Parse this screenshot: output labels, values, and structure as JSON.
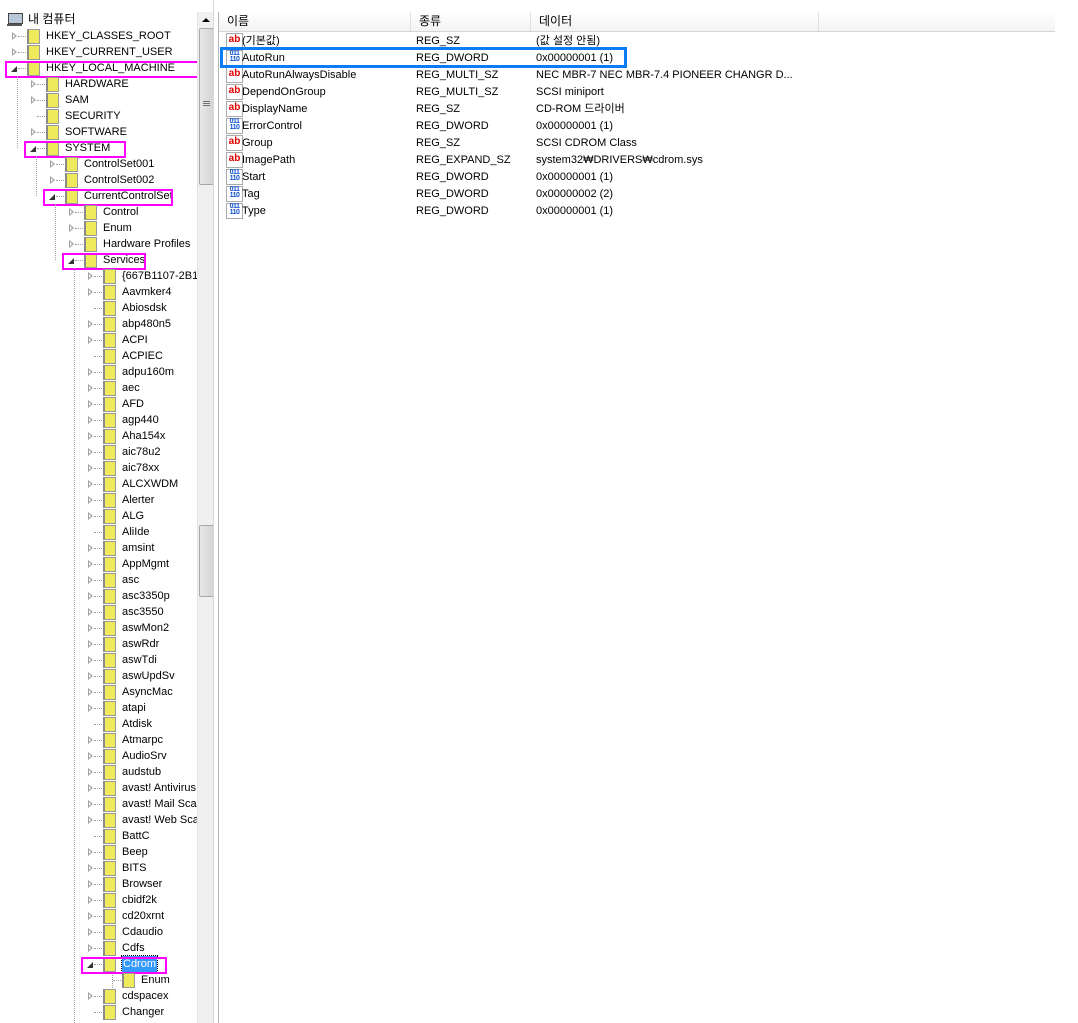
{
  "tree": {
    "root": {
      "label": "내 컴퓨터",
      "icon": "computer-icon"
    },
    "items": [
      {
        "label": "HKEY_CLASSES_ROOT",
        "level": 0,
        "state": "collapsed"
      },
      {
        "label": "HKEY_CURRENT_USER",
        "level": 0,
        "state": "collapsed"
      },
      {
        "label": "HKEY_LOCAL_MACHINE",
        "level": 0,
        "state": "expanded",
        "highlight": true
      },
      {
        "label": "HARDWARE",
        "level": 1,
        "state": "collapsed"
      },
      {
        "label": "SAM",
        "level": 1,
        "state": "collapsed"
      },
      {
        "label": "SECURITY",
        "level": 1,
        "state": "none"
      },
      {
        "label": "SOFTWARE",
        "level": 1,
        "state": "collapsed"
      },
      {
        "label": "SYSTEM",
        "level": 1,
        "state": "expanded",
        "highlight": true
      },
      {
        "label": "ControlSet001",
        "level": 2,
        "state": "collapsed"
      },
      {
        "label": "ControlSet002",
        "level": 2,
        "state": "collapsed"
      },
      {
        "label": "CurrentControlSet",
        "level": 2,
        "state": "expanded",
        "highlight": true
      },
      {
        "label": "Control",
        "level": 3,
        "state": "collapsed"
      },
      {
        "label": "Enum",
        "level": 3,
        "state": "collapsed"
      },
      {
        "label": "Hardware Profiles",
        "level": 3,
        "state": "collapsed"
      },
      {
        "label": "Services",
        "level": 3,
        "state": "expanded",
        "highlight": true
      },
      {
        "label": "{667B1107-2B1",
        "level": 4,
        "state": "collapsed"
      },
      {
        "label": "Aavmker4",
        "level": 4,
        "state": "collapsed"
      },
      {
        "label": "Abiosdsk",
        "level": 4,
        "state": "none"
      },
      {
        "label": "abp480n5",
        "level": 4,
        "state": "collapsed"
      },
      {
        "label": "ACPI",
        "level": 4,
        "state": "collapsed"
      },
      {
        "label": "ACPIEC",
        "level": 4,
        "state": "none"
      },
      {
        "label": "adpu160m",
        "level": 4,
        "state": "collapsed"
      },
      {
        "label": "aec",
        "level": 4,
        "state": "collapsed"
      },
      {
        "label": "AFD",
        "level": 4,
        "state": "collapsed"
      },
      {
        "label": "agp440",
        "level": 4,
        "state": "collapsed"
      },
      {
        "label": "Aha154x",
        "level": 4,
        "state": "collapsed"
      },
      {
        "label": "aic78u2",
        "level": 4,
        "state": "collapsed"
      },
      {
        "label": "aic78xx",
        "level": 4,
        "state": "collapsed"
      },
      {
        "label": "ALCXWDM",
        "level": 4,
        "state": "collapsed"
      },
      {
        "label": "Alerter",
        "level": 4,
        "state": "collapsed"
      },
      {
        "label": "ALG",
        "level": 4,
        "state": "collapsed"
      },
      {
        "label": "AliIde",
        "level": 4,
        "state": "none"
      },
      {
        "label": "amsint",
        "level": 4,
        "state": "collapsed"
      },
      {
        "label": "AppMgmt",
        "level": 4,
        "state": "collapsed"
      },
      {
        "label": "asc",
        "level": 4,
        "state": "collapsed"
      },
      {
        "label": "asc3350p",
        "level": 4,
        "state": "collapsed"
      },
      {
        "label": "asc3550",
        "level": 4,
        "state": "collapsed"
      },
      {
        "label": "aswMon2",
        "level": 4,
        "state": "collapsed"
      },
      {
        "label": "aswRdr",
        "level": 4,
        "state": "collapsed"
      },
      {
        "label": "aswTdi",
        "level": 4,
        "state": "collapsed"
      },
      {
        "label": "aswUpdSv",
        "level": 4,
        "state": "collapsed"
      },
      {
        "label": "AsyncMac",
        "level": 4,
        "state": "collapsed"
      },
      {
        "label": "atapi",
        "level": 4,
        "state": "collapsed"
      },
      {
        "label": "Atdisk",
        "level": 4,
        "state": "none"
      },
      {
        "label": "Atmarpc",
        "level": 4,
        "state": "collapsed"
      },
      {
        "label": "AudioSrv",
        "level": 4,
        "state": "collapsed"
      },
      {
        "label": "audstub",
        "level": 4,
        "state": "collapsed"
      },
      {
        "label": "avast! Antivirus",
        "level": 4,
        "state": "collapsed"
      },
      {
        "label": "avast! Mail Scar",
        "level": 4,
        "state": "collapsed"
      },
      {
        "label": "avast! Web Sca",
        "level": 4,
        "state": "collapsed"
      },
      {
        "label": "BattC",
        "level": 4,
        "state": "none"
      },
      {
        "label": "Beep",
        "level": 4,
        "state": "collapsed"
      },
      {
        "label": "BITS",
        "level": 4,
        "state": "collapsed"
      },
      {
        "label": "Browser",
        "level": 4,
        "state": "collapsed"
      },
      {
        "label": "cbidf2k",
        "level": 4,
        "state": "collapsed"
      },
      {
        "label": "cd20xrnt",
        "level": 4,
        "state": "collapsed"
      },
      {
        "label": "Cdaudio",
        "level": 4,
        "state": "collapsed"
      },
      {
        "label": "Cdfs",
        "level": 4,
        "state": "collapsed"
      },
      {
        "label": "Cdrom",
        "level": 4,
        "state": "expanded",
        "highlight": true,
        "selected": true
      },
      {
        "label": "Enum",
        "level": 5,
        "state": "none"
      },
      {
        "label": "cdspacex",
        "level": 4,
        "state": "collapsed"
      },
      {
        "label": "Changer",
        "level": 4,
        "state": "none"
      }
    ]
  },
  "list": {
    "columns": [
      "이름",
      "종류",
      "데이터"
    ],
    "rows": [
      {
        "name": "(기본값)",
        "type": "REG_SZ",
        "data": "(값 설정 안됨)",
        "icon": "string"
      },
      {
        "name": "AutoRun",
        "type": "REG_DWORD",
        "data": "0x00000001 (1)",
        "icon": "binary",
        "highlight": true
      },
      {
        "name": "AutoRunAlwaysDisable",
        "type": "REG_MULTI_SZ",
        "data": "NEC     MBR-7   NEC     MBR-7.4  PIONEER CHANGR D...",
        "icon": "string"
      },
      {
        "name": "DependOnGroup",
        "type": "REG_MULTI_SZ",
        "data": "SCSI miniport",
        "icon": "string"
      },
      {
        "name": "DisplayName",
        "type": "REG_SZ",
        "data": "CD-ROM 드라이버",
        "icon": "string"
      },
      {
        "name": "ErrorControl",
        "type": "REG_DWORD",
        "data": "0x00000001 (1)",
        "icon": "binary"
      },
      {
        "name": "Group",
        "type": "REG_SZ",
        "data": "SCSI CDROM Class",
        "icon": "string"
      },
      {
        "name": "ImagePath",
        "type": "REG_EXPAND_SZ",
        "data": "system32₩DRIVERS₩cdrom.sys",
        "icon": "string"
      },
      {
        "name": "Start",
        "type": "REG_DWORD",
        "data": "0x00000001 (1)",
        "icon": "binary"
      },
      {
        "name": "Tag",
        "type": "REG_DWORD",
        "data": "0x00000002 (2)",
        "icon": "binary"
      },
      {
        "name": "Type",
        "type": "REG_DWORD",
        "data": "0x00000001 (1)",
        "icon": "binary"
      }
    ]
  },
  "icons": {
    "string": "ab",
    "binary": "011\n110"
  },
  "colors": {
    "highlight": "#ff00ff",
    "value_highlight": "#0a7cf4",
    "selection": "#3399ff"
  }
}
